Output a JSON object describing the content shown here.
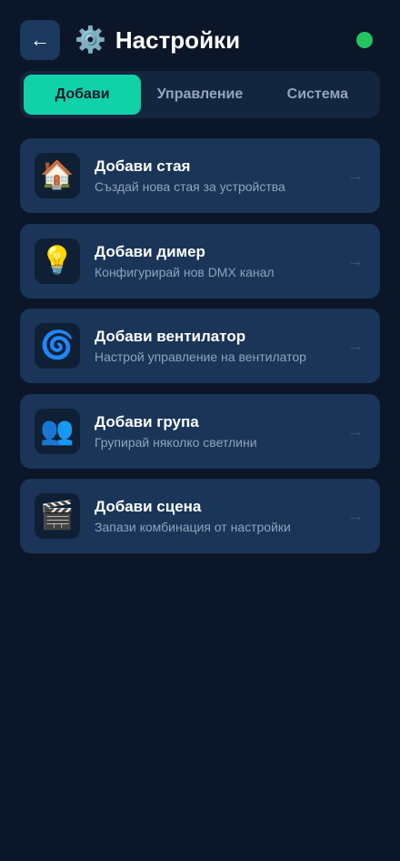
{
  "header": {
    "back_icon": "←",
    "title_icon": "⚙️",
    "title": "Настройки",
    "status_color": "#22c55e"
  },
  "tabs": [
    {
      "label": "Добави",
      "active": true
    },
    {
      "label": "Управление",
      "active": false
    },
    {
      "label": "Система",
      "active": false
    }
  ],
  "cards": [
    {
      "icon": "🏠",
      "icon_name": "house-icon",
      "title": "Добави стая",
      "subtitle": "Създай нова стая за устройства",
      "arrow": "→"
    },
    {
      "icon": "💡",
      "icon_name": "light-bulb-icon",
      "title": "Добави димер",
      "subtitle": "Конфигурирай нов DMX канал",
      "arrow": "→"
    },
    {
      "icon": "🌀",
      "icon_name": "cyclone-icon",
      "title": "Добави вентилатор",
      "subtitle": "Настрой управление на вентилатор",
      "arrow": "→"
    },
    {
      "icon": "👥",
      "icon_name": "group-icon",
      "title": "Добави група",
      "subtitle": "Групирай няколко светлини",
      "arrow": "→"
    },
    {
      "icon": "🎬",
      "icon_name": "clapper-board-icon",
      "title": "Добави сцена",
      "subtitle": "Запази комбинация от настройки",
      "arrow": "→"
    }
  ],
  "colors": {
    "background": "#0b1628",
    "card": "#1a3558",
    "accent": "#10d1a8"
  }
}
